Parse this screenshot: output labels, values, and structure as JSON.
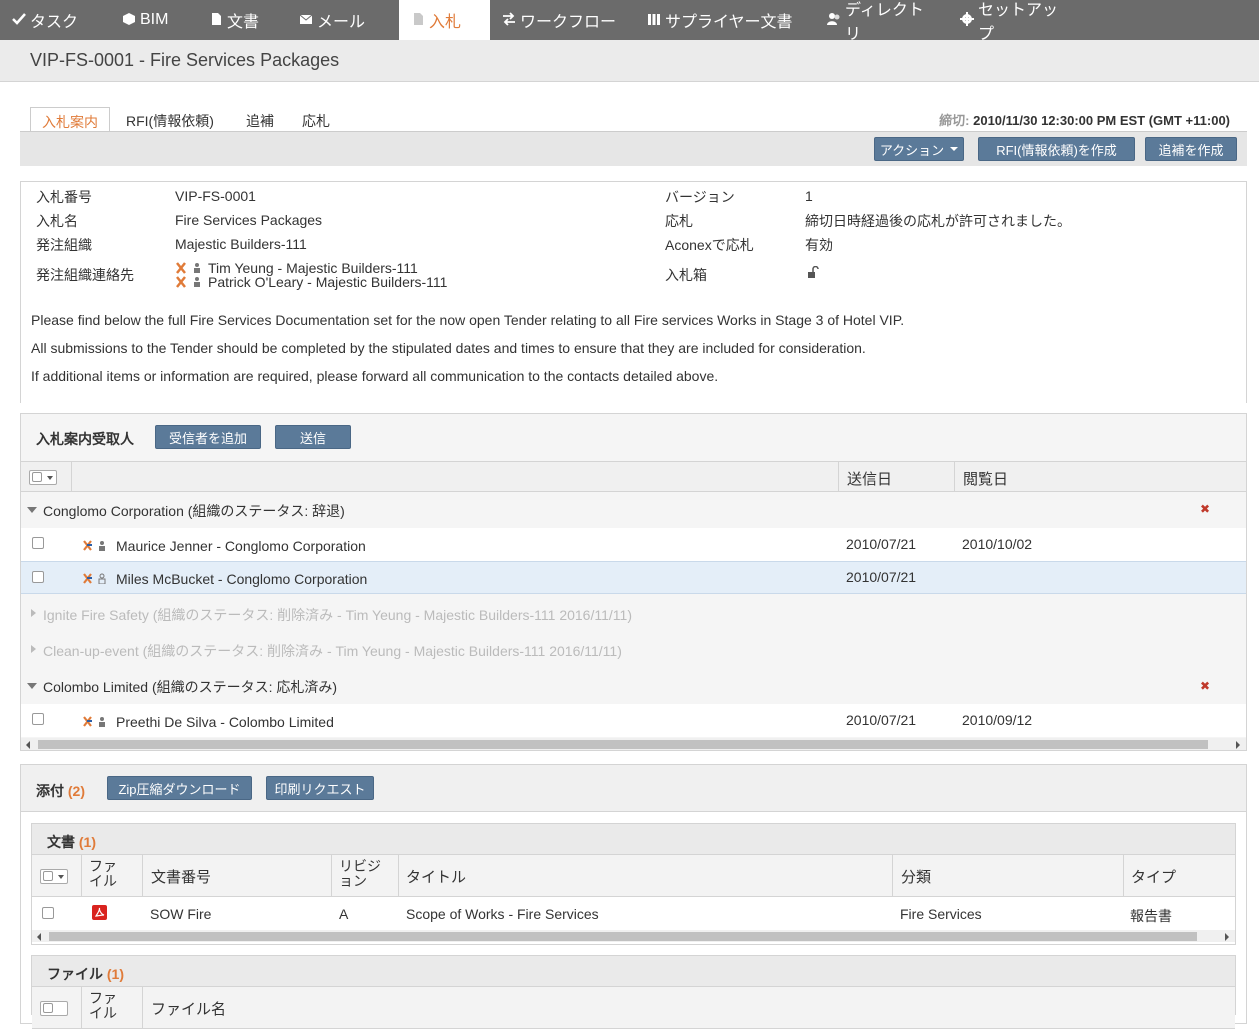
{
  "nav": {
    "items": [
      {
        "label": "タスク",
        "icon": "check-icon"
      },
      {
        "label": "BIM",
        "icon": "cube-icon"
      },
      {
        "label": "文書",
        "icon": "document-icon"
      },
      {
        "label": "メール",
        "icon": "mail-icon"
      },
      {
        "label": "入札",
        "icon": "tender-icon",
        "active": true
      },
      {
        "label": "ワークフロー",
        "icon": "workflow-icon"
      },
      {
        "label": "サプライヤー文書",
        "icon": "supplier-icon"
      },
      {
        "label": "ディレクトリ",
        "icon": "users-icon"
      },
      {
        "label": "セットアップ",
        "icon": "gear-icon"
      }
    ]
  },
  "page_title": "VIP-FS-0001 - Fire Services Packages",
  "tabs": [
    "入札案内",
    "RFI(情報依頼)",
    "追補",
    "応札"
  ],
  "deadline": {
    "label": "締切:",
    "value": "2010/11/30 12:30:00 PM EST (GMT +11:00)"
  },
  "actions": {
    "action_label": "アクション",
    "rfi_label": "RFI(情報依頼)を作成",
    "addendum_label": "追補を作成"
  },
  "details": {
    "tender_no_label": "入札番号",
    "tender_no": "VIP-FS-0001",
    "tender_name_label": "入札名",
    "tender_name": "Fire Services Packages",
    "org_label": "発注組織",
    "org": "Majestic Builders-111",
    "contact_label": "発注組織連絡先",
    "contacts": [
      "Tim Yeung - Majestic Builders-111",
      "Patrick O'Leary - Majestic Builders-111"
    ],
    "version_label": "バージョン",
    "version": "1",
    "response_label": "応札",
    "response": "締切日時経過後の応札が許可されました。",
    "aconex_label": "Aconexで応札",
    "aconex": "有効",
    "box_label": "入札箱"
  },
  "description": [
    "Please find below the full Fire Services Documentation set for the now open Tender relating to all Fire services Works in Stage 3 of Hotel VIP.",
    "All submissions to the Tender should be completed by the stipulated dates and times to ensure that they are included for consideration.",
    "If additional items or information are required, please forward all communication to the contacts detailed above."
  ],
  "recipients": {
    "title": "入札案内受取人",
    "add_label": "受信者を追加",
    "send_label": "送信",
    "col_sent": "送信日",
    "col_viewed": "閲覧日",
    "groups": [
      {
        "name": "Conglomo Corporation (組織のステータス: 辞退)",
        "state": "expanded"
      },
      {
        "name": "Ignite Fire Safety (組織のステータス: 削除済み - Tim Yeung - Majestic Builders-111 2016/11/11)",
        "state": "collapsed"
      },
      {
        "name": "Clean-up-event (組織のステータス: 削除済み - Tim Yeung - Majestic Builders-111 2016/11/11)",
        "state": "collapsed"
      },
      {
        "name": "Colombo Limited (組織のステータス: 応札済み)",
        "state": "expanded"
      }
    ],
    "rows": [
      {
        "name": "Maurice Jenner - Conglomo Corporation",
        "sent": "2010/07/21",
        "viewed": "2010/10/02"
      },
      {
        "name": "Miles McBucket - Conglomo Corporation",
        "sent": "2010/07/21",
        "viewed": ""
      },
      {
        "name": "Preethi De Silva - Colombo Limited",
        "sent": "2010/07/21",
        "viewed": "2010/09/12"
      }
    ]
  },
  "attachments": {
    "title": "添付",
    "count": "(2)",
    "zip_label": "Zip圧縮ダウンロード",
    "print_label": "印刷リクエスト",
    "docs": {
      "title": "文書",
      "count": "(1)",
      "cols": [
        "ファイル",
        "文書番号",
        "リビジョン",
        "タイトル",
        "分類",
        "タイプ"
      ],
      "rows": [
        {
          "number": "SOW Fire",
          "revision": "A",
          "title": "Scope of Works - Fire Services",
          "category": "Fire Services",
          "type": "報告書"
        }
      ]
    },
    "files": {
      "title": "ファイル",
      "count": "(1)",
      "cols": [
        "ファイル",
        "ファイル名"
      ]
    }
  }
}
